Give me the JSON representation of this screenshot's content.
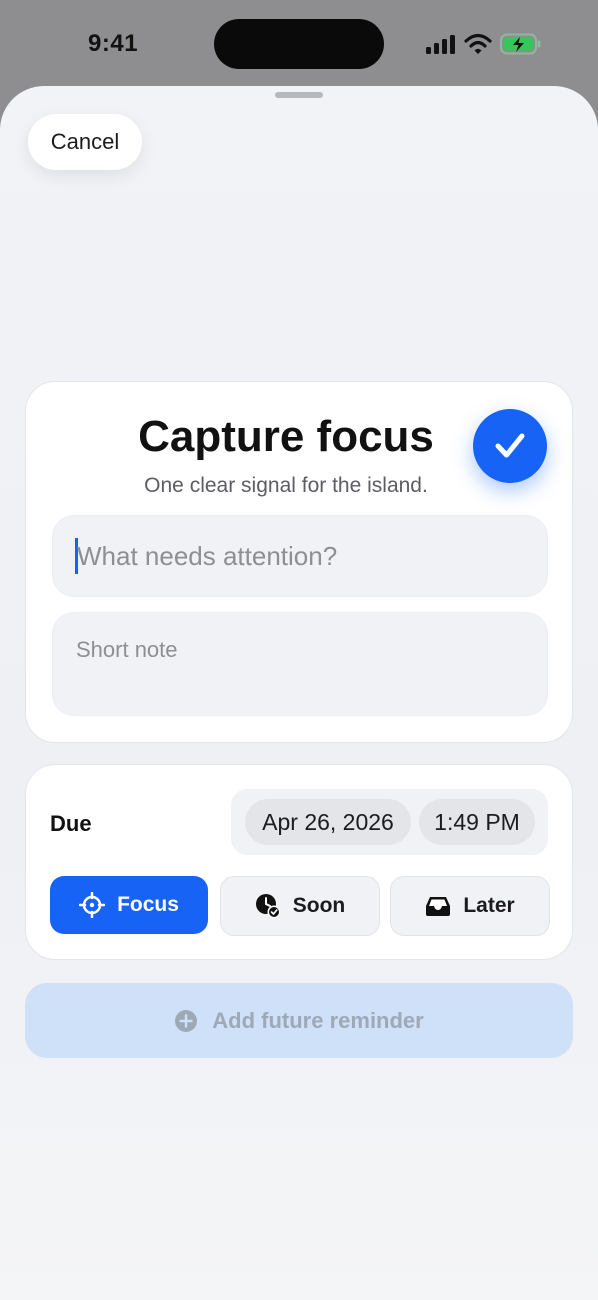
{
  "status_bar": {
    "time": "9:41",
    "icons": [
      "signal-icon",
      "wifi-icon",
      "battery-charging-icon"
    ]
  },
  "sheet": {
    "cancel_label": "Cancel"
  },
  "capture": {
    "title": "Capture focus",
    "subtitle": "One clear signal for the island.",
    "title_placeholder": "What needs attention?",
    "note_placeholder": "Short note"
  },
  "due": {
    "label": "Due",
    "date": "Apr 26, 2026",
    "time": "1:49 PM",
    "options": [
      {
        "label": "Focus",
        "icon": "crosshair-icon",
        "selected": true
      },
      {
        "label": "Soon",
        "icon": "clock-check-icon",
        "selected": false
      },
      {
        "label": "Later",
        "icon": "tray-icon",
        "selected": false
      }
    ]
  },
  "add_reminder_label": "Add future reminder",
  "colors": {
    "accent": "#1663f5",
    "battery": "#34c759",
    "disabled_button": "#cfe0f9"
  }
}
